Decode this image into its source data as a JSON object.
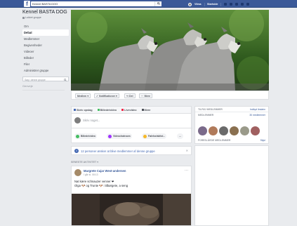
{
  "topbar": {
    "search_value": "Kennel BASTA DOG",
    "user_name": "Vilma",
    "home_label": "Startside"
  },
  "sidebar": {
    "group_name": "Kennel BASTA DOG",
    "group_type": "Lukket gruppe",
    "items": [
      {
        "label": "Om"
      },
      {
        "label": "Debat"
      },
      {
        "label": "Medlemmer"
      },
      {
        "label": "Begivenheder"
      },
      {
        "label": "Videoer"
      },
      {
        "label": "Billeder"
      },
      {
        "label": "Filer"
      },
      {
        "label": "Administrer gruppe"
      }
    ],
    "search_placeholder": "Søg i denne gruppe",
    "shortcuts_heading": "Genveje"
  },
  "actions": {
    "member": "Medlem",
    "notifications": "Notifikationer",
    "share": "Del",
    "more": "Mere"
  },
  "composer": {
    "tabs": [
      "Skriv opslag",
      "Billede/video",
      "Livevideo",
      "Mere"
    ],
    "placeholder": "Skriv noget...",
    "options": [
      "Billede/video",
      "Videochatroom",
      "Følelse/aktivi...",
      "..."
    ]
  },
  "notice": {
    "text": "12 personer ønsker at blive medlemmer af denne gruppe"
  },
  "recent_label": "SENESTE AKTIVITET",
  "post": {
    "author": "Margrete Cajar West-andersen",
    "time": "I går kl. 08:13",
    "line1": "Nat kære schnauzer venner ❤",
    "line2": "Olga 🐶 og Trunte 🐶 i tilbørgete, a seng"
  },
  "members_box": {
    "title": "TILFØJ MEDLEMMER",
    "invite": "Indbyd lindahn",
    "label": "MEDLEMMER",
    "count": "30 medlemmer",
    "suggested": "FORESLÅEDE MEDLEMMER",
    "see_all": "Skjul"
  },
  "colors": {
    "brand": "#3b5998",
    "link": "#365899",
    "background": "#e9ebee"
  }
}
